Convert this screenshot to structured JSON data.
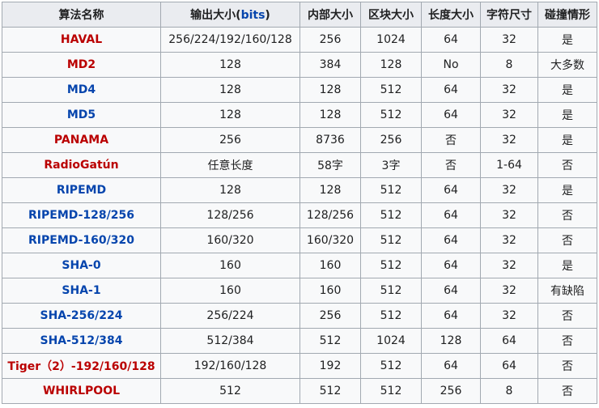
{
  "table": {
    "headers": {
      "name": "算法名称",
      "output_prefix": "输出大小(",
      "output_link": "bits",
      "output_suffix": ")",
      "internal": "内部大小",
      "block": "区块大小",
      "length": "长度大小",
      "word": "字符尺寸",
      "collision": "碰撞情形"
    },
    "rows": [
      {
        "name": "HAVAL",
        "link_color": "red",
        "output": "256/224/192/160/128",
        "internal": "256",
        "block": "1024",
        "length": "64",
        "word": "32",
        "collision": "是"
      },
      {
        "name": "MD2",
        "link_color": "red",
        "output": "128",
        "internal": "384",
        "block": "128",
        "length": "No",
        "word": "8",
        "collision": "大多数"
      },
      {
        "name": "MD4",
        "link_color": "blue",
        "output": "128",
        "internal": "128",
        "block": "512",
        "length": "64",
        "word": "32",
        "collision": "是"
      },
      {
        "name": "MD5",
        "link_color": "blue",
        "output": "128",
        "internal": "128",
        "block": "512",
        "length": "64",
        "word": "32",
        "collision": "是"
      },
      {
        "name": "PANAMA",
        "link_color": "red",
        "output": "256",
        "internal": "8736",
        "block": "256",
        "length": "否",
        "word": "32",
        "collision": "是"
      },
      {
        "name": "RadioGatún",
        "link_color": "red",
        "output": "任意长度",
        "internal": "58字",
        "block": "3字",
        "length": "否",
        "word": "1-64",
        "collision": "否"
      },
      {
        "name": "RIPEMD",
        "link_color": "blue",
        "output": "128",
        "internal": "128",
        "block": "512",
        "length": "64",
        "word": "32",
        "collision": "是"
      },
      {
        "name": "RIPEMD-128/256",
        "link_color": "blue",
        "output": "128/256",
        "internal": "128/256",
        "block": "512",
        "length": "64",
        "word": "32",
        "collision": "否"
      },
      {
        "name": "RIPEMD-160/320",
        "link_color": "blue",
        "output": "160/320",
        "internal": "160/320",
        "block": "512",
        "length": "64",
        "word": "32",
        "collision": "否"
      },
      {
        "name": "SHA-0",
        "link_color": "blue",
        "output": "160",
        "internal": "160",
        "block": "512",
        "length": "64",
        "word": "32",
        "collision": "是"
      },
      {
        "name": "SHA-1",
        "link_color": "blue",
        "output": "160",
        "internal": "160",
        "block": "512",
        "length": "64",
        "word": "32",
        "collision": "有缺陷"
      },
      {
        "name": "SHA-256/224",
        "link_color": "blue",
        "output": "256/224",
        "internal": "256",
        "block": "512",
        "length": "64",
        "word": "32",
        "collision": "否"
      },
      {
        "name": "SHA-512/384",
        "link_color": "blue",
        "output": "512/384",
        "internal": "512",
        "block": "1024",
        "length": "128",
        "word": "64",
        "collision": "否"
      },
      {
        "name": "Tiger（2）-192/160/128",
        "link_color": "red",
        "output": "192/160/128",
        "internal": "192",
        "block": "512",
        "length": "64",
        "word": "64",
        "collision": "否"
      },
      {
        "name": "WHIRLPOOL",
        "link_color": "red",
        "output": "512",
        "internal": "512",
        "block": "512",
        "length": "256",
        "word": "8",
        "collision": "否"
      }
    ]
  }
}
